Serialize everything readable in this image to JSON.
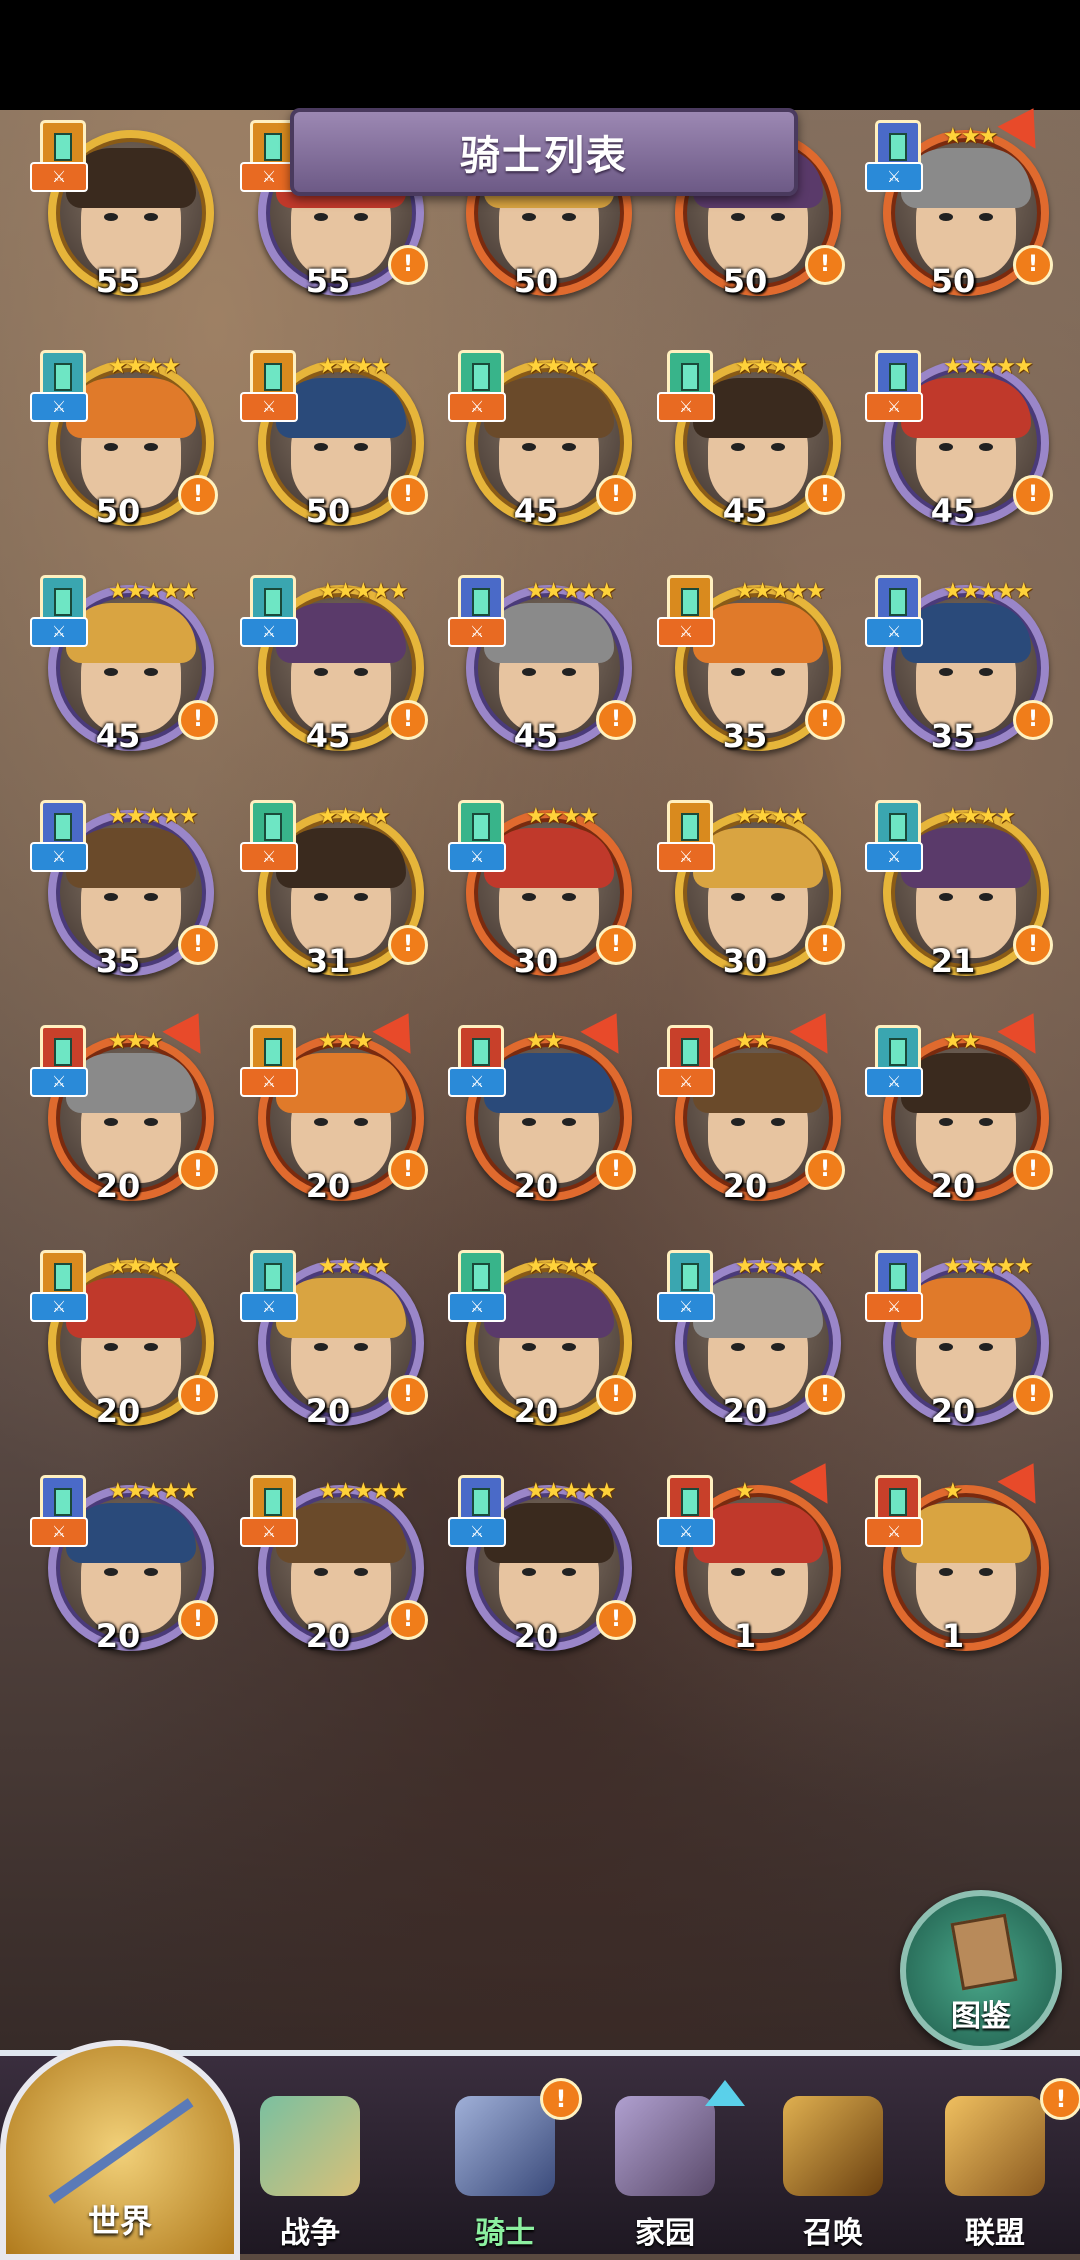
{
  "header": {
    "title": "骑士列表"
  },
  "knights": [
    {
      "level": "55",
      "stars": "",
      "frame": "gold",
      "cls": "orange",
      "role": "orange",
      "alert": false
    },
    {
      "level": "55",
      "stars": "",
      "frame": "purple",
      "cls": "orange",
      "role": "orange",
      "alert": true
    },
    {
      "level": "50",
      "stars": "",
      "frame": "orange",
      "cls": "orange",
      "role": "orange",
      "alert": false
    },
    {
      "level": "50",
      "stars": "",
      "frame": "orange",
      "cls": "orange",
      "role": "orange",
      "alert": true
    },
    {
      "level": "50",
      "stars": "★★★",
      "frame": "orange",
      "cls": "blue",
      "role": "blue",
      "alert": true
    },
    {
      "level": "50",
      "stars": "★★★★",
      "frame": "gold",
      "cls": "teal",
      "role": "blue",
      "alert": true
    },
    {
      "level": "50",
      "stars": "★★★★",
      "frame": "gold",
      "cls": "orange",
      "role": "orange",
      "alert": true
    },
    {
      "level": "45",
      "stars": "★★★★",
      "frame": "gold",
      "cls": "green",
      "role": "orange",
      "alert": true
    },
    {
      "level": "45",
      "stars": "★★★★",
      "frame": "gold",
      "cls": "green",
      "role": "orange",
      "alert": true
    },
    {
      "level": "45",
      "stars": "★★★★★",
      "frame": "purple",
      "cls": "blue",
      "role": "orange",
      "alert": true
    },
    {
      "level": "45",
      "stars": "★★★★★",
      "frame": "purple",
      "cls": "teal",
      "role": "blue",
      "alert": true
    },
    {
      "level": "45",
      "stars": "★★★★★",
      "frame": "gold",
      "cls": "teal",
      "role": "blue",
      "alert": true
    },
    {
      "level": "45",
      "stars": "★★★★★",
      "frame": "purple",
      "cls": "blue",
      "role": "orange",
      "alert": true
    },
    {
      "level": "35",
      "stars": "★★★★★",
      "frame": "gold",
      "cls": "orange",
      "role": "orange",
      "alert": true
    },
    {
      "level": "35",
      "stars": "★★★★★",
      "frame": "purple",
      "cls": "blue",
      "role": "blue",
      "alert": true
    },
    {
      "level": "35",
      "stars": "★★★★★",
      "frame": "purple",
      "cls": "blue",
      "role": "blue",
      "alert": true
    },
    {
      "level": "31",
      "stars": "★★★★",
      "frame": "gold",
      "cls": "green",
      "role": "orange",
      "alert": true
    },
    {
      "level": "30",
      "stars": "★★★★",
      "frame": "orange",
      "cls": "green",
      "role": "blue",
      "alert": true
    },
    {
      "level": "30",
      "stars": "★★★★",
      "frame": "gold",
      "cls": "orange",
      "role": "orange",
      "alert": true
    },
    {
      "level": "21",
      "stars": "★★★★",
      "frame": "gold",
      "cls": "teal",
      "role": "blue",
      "alert": true
    },
    {
      "level": "20",
      "stars": "★★★",
      "frame": "orange",
      "cls": "red",
      "role": "blue",
      "alert": true
    },
    {
      "level": "20",
      "stars": "★★★",
      "frame": "orange",
      "cls": "orange",
      "role": "orange",
      "alert": true
    },
    {
      "level": "20",
      "stars": "★★",
      "frame": "orange",
      "cls": "red",
      "role": "blue",
      "alert": true
    },
    {
      "level": "20",
      "stars": "★★",
      "frame": "orange",
      "cls": "red",
      "role": "orange",
      "alert": true
    },
    {
      "level": "20",
      "stars": "★★",
      "frame": "orange",
      "cls": "teal",
      "role": "blue",
      "alert": true
    },
    {
      "level": "20",
      "stars": "★★★★",
      "frame": "gold",
      "cls": "orange",
      "role": "blue",
      "alert": true
    },
    {
      "level": "20",
      "stars": "★★★★",
      "frame": "purple",
      "cls": "teal",
      "role": "blue",
      "alert": true
    },
    {
      "level": "20",
      "stars": "★★★★",
      "frame": "gold",
      "cls": "green",
      "role": "blue",
      "alert": true
    },
    {
      "level": "20",
      "stars": "★★★★★",
      "frame": "purple",
      "cls": "teal",
      "role": "blue",
      "alert": true
    },
    {
      "level": "20",
      "stars": "★★★★★",
      "frame": "purple",
      "cls": "blue",
      "role": "orange",
      "alert": true
    },
    {
      "level": "20",
      "stars": "★★★★★",
      "frame": "purple",
      "cls": "blue",
      "role": "orange",
      "alert": true
    },
    {
      "level": "20",
      "stars": "★★★★★",
      "frame": "purple",
      "cls": "orange",
      "role": "orange",
      "alert": true
    },
    {
      "level": "20",
      "stars": "★★★★★",
      "frame": "purple",
      "cls": "blue",
      "role": "blue",
      "alert": true
    },
    {
      "level": "1",
      "stars": "★",
      "frame": "orange",
      "cls": "red",
      "role": "blue",
      "alert": false
    },
    {
      "level": "1",
      "stars": "★",
      "frame": "orange",
      "cls": "red",
      "role": "orange",
      "alert": false
    }
  ],
  "atlas": {
    "label": "图鉴"
  },
  "nav": {
    "world": "世界",
    "war": "战争",
    "knight": "骑士",
    "home": "家园",
    "summon": "召唤",
    "alliance": "联盟"
  }
}
